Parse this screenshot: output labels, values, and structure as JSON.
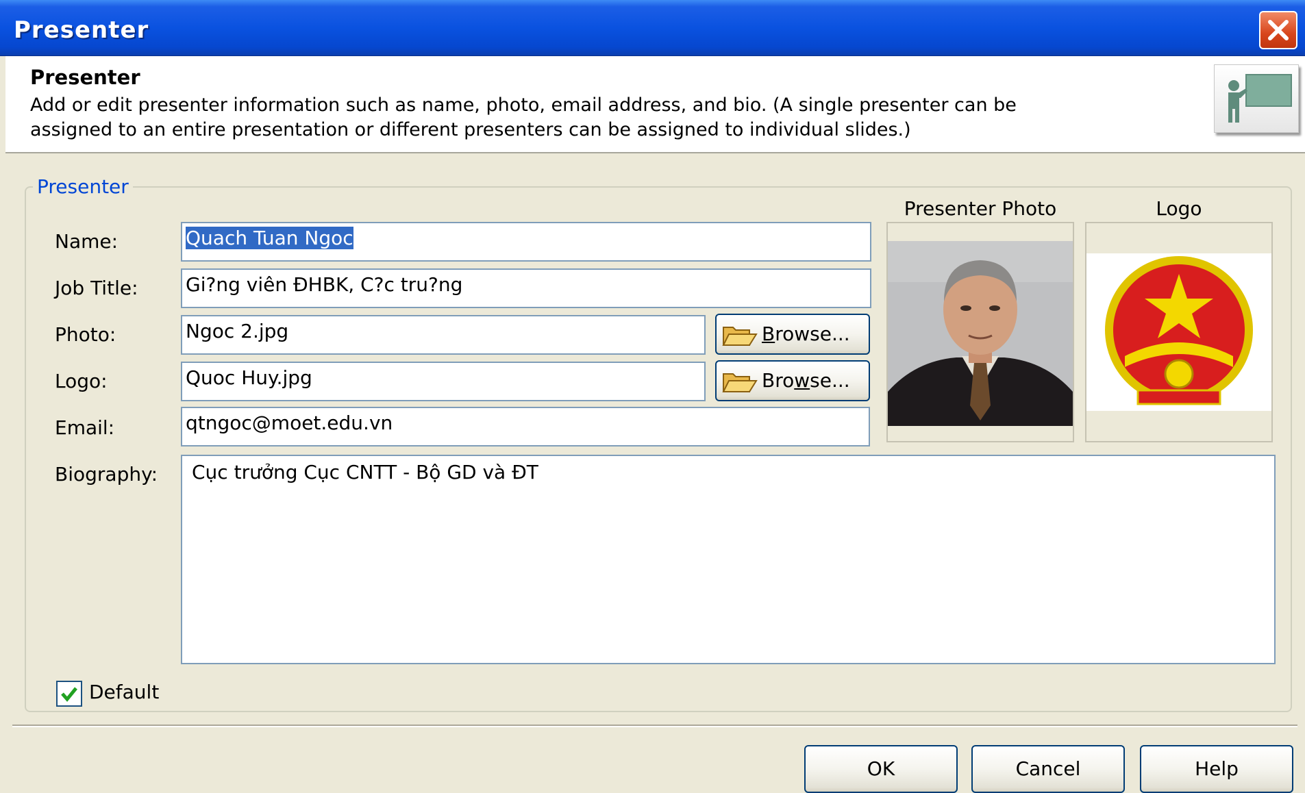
{
  "window": {
    "title": "Presenter"
  },
  "header": {
    "title": "Presenter",
    "description_line1": "Add or edit presenter information such as name, photo, email address, and bio. (A single presenter can be",
    "description_line2": "assigned to an entire presentation or different presenters can be assigned to individual slides.)",
    "icon": "presenter-board-icon"
  },
  "group": {
    "legend": "Presenter"
  },
  "fields": {
    "name": {
      "label": "Name:",
      "value": "Quach Tuan Ngoc"
    },
    "job_title": {
      "label": "Job Title:",
      "value": "Gi?ng viên ĐHBK, C?c tru?ng"
    },
    "photo": {
      "label": "Photo:",
      "value": "Ngoc 2.jpg",
      "browse_pre": "",
      "browse_mnemonic": "B",
      "browse_post": "rowse..."
    },
    "logo": {
      "label": "Logo:",
      "value": "Quoc Huy.jpg",
      "browse_pre": "Bro",
      "browse_mnemonic": "w",
      "browse_post": "se..."
    },
    "email": {
      "label": "Email:",
      "value": "qtngoc@moet.edu.vn"
    },
    "biography": {
      "label": "Biography:",
      "value": "Cục trưởng Cục CNTT - Bộ GD và ĐT"
    }
  },
  "previews": {
    "photo_caption": "Presenter Photo",
    "logo_caption": "Logo"
  },
  "default_checkbox": {
    "label": "Default",
    "checked": true
  },
  "buttons": {
    "ok": "OK",
    "cancel": "Cancel",
    "help": "Help"
  }
}
